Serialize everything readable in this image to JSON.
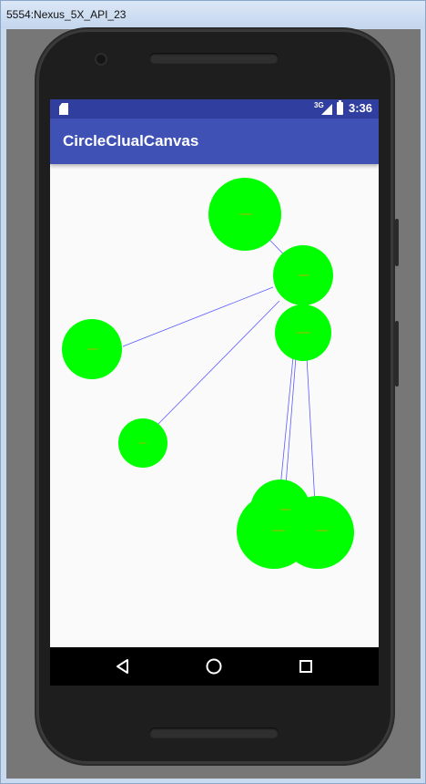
{
  "window": {
    "title": "5554:Nexus_5X_API_23"
  },
  "status_bar": {
    "network": "3G",
    "time": "3:36",
    "icons": [
      "sd-card-icon",
      "signal-icon",
      "battery-icon"
    ]
  },
  "app": {
    "title": "CircleClualCanvas",
    "colors": {
      "status_bar": "#303f9f",
      "app_bar": "#3f51b5",
      "circle_fill": "#00ff00",
      "link_line": "#5a5aff",
      "canvas_bg": "#fafafa"
    }
  },
  "navigation": {
    "buttons": [
      "back-icon",
      "home-icon",
      "recents-icon"
    ]
  }
}
